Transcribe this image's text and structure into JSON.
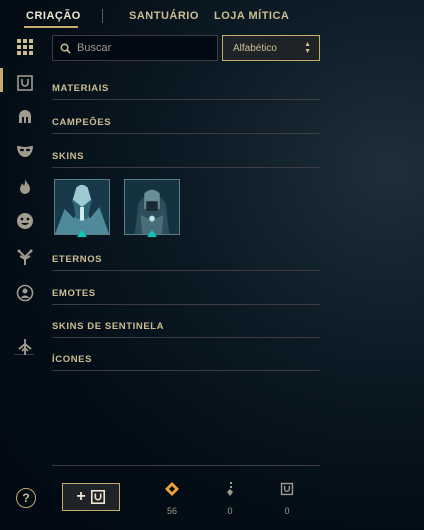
{
  "nav": {
    "tabs": [
      {
        "label": "CRIAÇÃO",
        "active": true
      },
      {
        "label": "SANTUÁRIO",
        "active": false
      },
      {
        "label": "LOJA MÍTICA",
        "active": false
      }
    ]
  },
  "sidebar": {
    "icons": [
      "grid-icon",
      "chest-icon",
      "helmet-icon",
      "mask-icon",
      "flame-icon",
      "smiley-icon",
      "tree-icon",
      "emote-icon",
      "ward-icon"
    ],
    "active_index": 0
  },
  "search": {
    "placeholder": "Buscar",
    "value": ""
  },
  "sort": {
    "label": "Alfabético"
  },
  "sections": [
    {
      "title": "MATERIAIS"
    },
    {
      "title": "CAMPEÕES"
    },
    {
      "title": "SKINS"
    },
    {
      "title": "ETERNOS"
    },
    {
      "title": "EMOTES"
    },
    {
      "title": "SKINS DE SENTINELA"
    },
    {
      "title": "ÍCONES"
    }
  ],
  "skins": [
    {
      "icon": "skin-portrait-icon"
    },
    {
      "icon": "skin-portrait-icon"
    }
  ],
  "bottom": {
    "help_label": "?",
    "craft_label": "+",
    "currencies": [
      {
        "icon": "orange-essence-icon",
        "count": "56"
      },
      {
        "icon": "key-icon",
        "count": "0"
      },
      {
        "icon": "chest-icon",
        "count": "0"
      }
    ]
  },
  "colors": {
    "gold": "#c8aa6e",
    "gold_text": "#cdbe91",
    "background": "#010a13",
    "teal": "#0ac8b9",
    "orange_essence": "#f0a13c"
  }
}
